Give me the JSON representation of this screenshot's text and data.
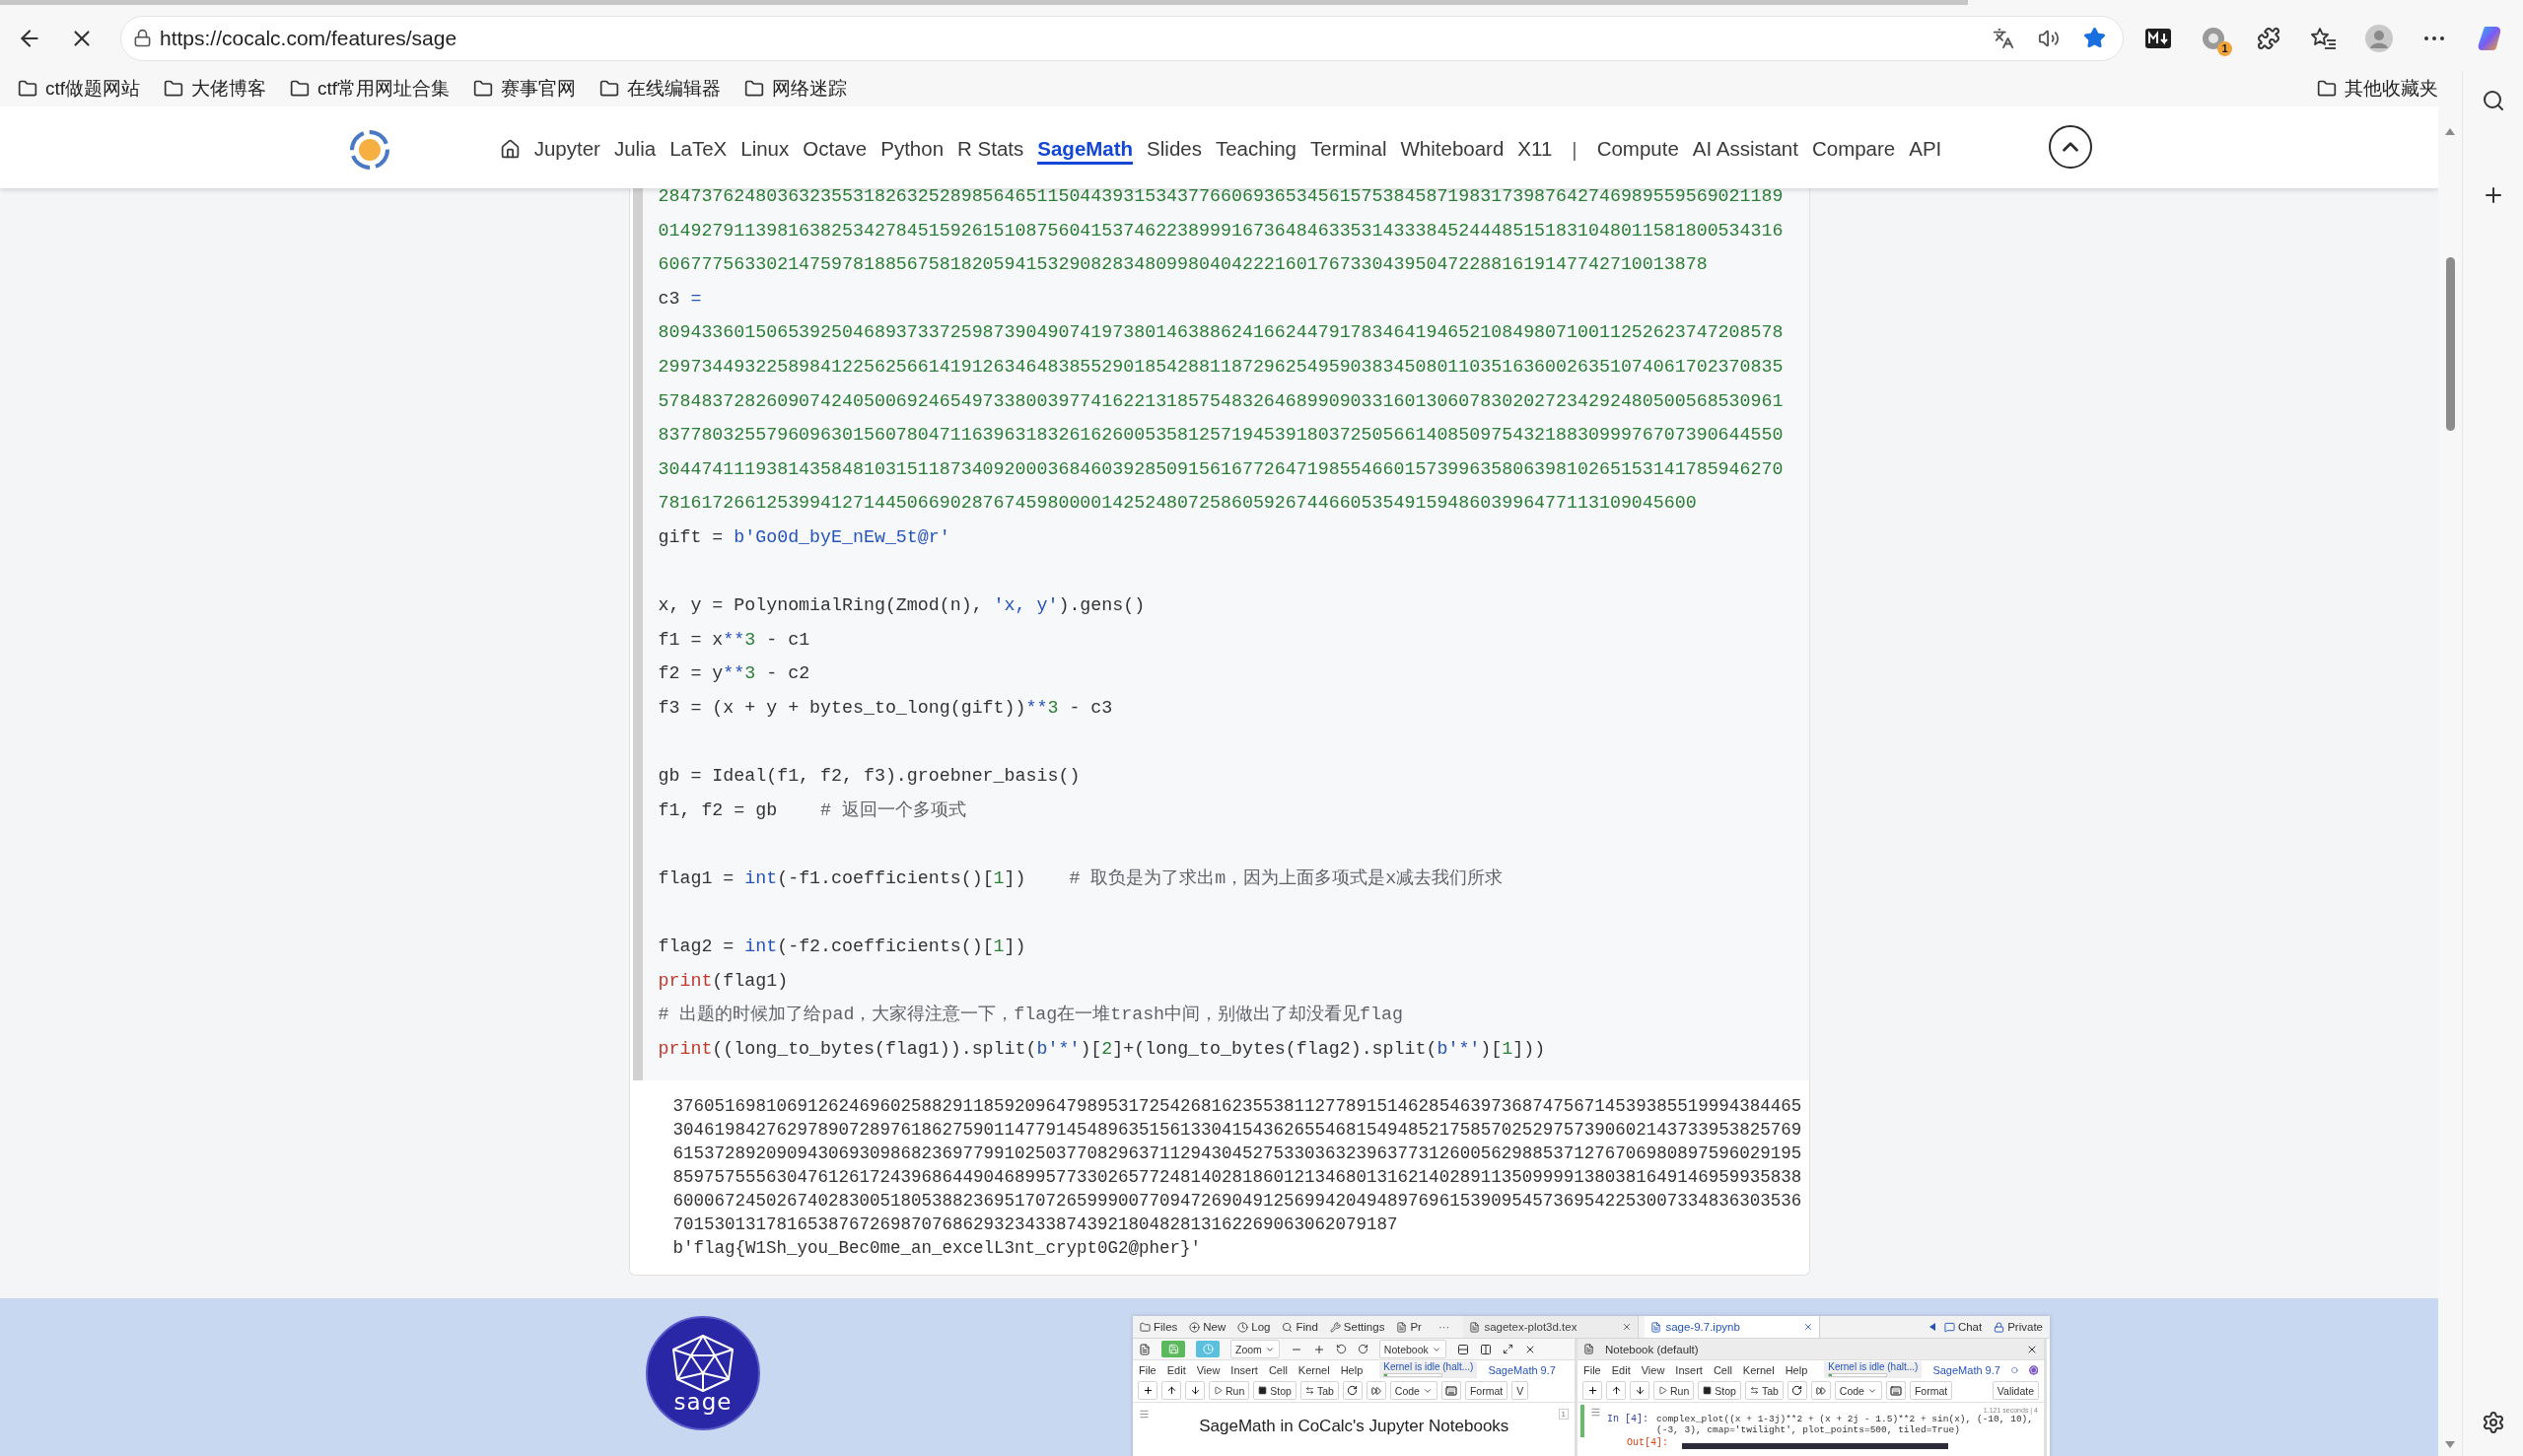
{
  "browser": {
    "load_progress": {
      "level": 0.78
    },
    "url": "https://cocalc.com/features/sage",
    "bookmarked": true,
    "extension_badge": "1",
    "bookmarks": [
      "ctf做题网站",
      "大佬博客",
      "ctf常用网址合集",
      "赛事官网",
      "在线编辑器",
      "网络迷踪"
    ],
    "other_bookmarks": "其他收藏夹"
  },
  "site_header": {
    "nav": [
      {
        "kind": "home",
        "selected": false
      },
      {
        "kind": "link",
        "label": "Jupyter",
        "selected": false
      },
      {
        "kind": "link",
        "label": "Julia",
        "selected": false
      },
      {
        "kind": "link",
        "label": "LaTeX",
        "selected": false
      },
      {
        "kind": "link",
        "label": "Linux",
        "selected": false
      },
      {
        "kind": "link",
        "label": "Octave",
        "selected": false
      },
      {
        "kind": "link",
        "label": "Python",
        "selected": false
      },
      {
        "kind": "link",
        "label": "R Stats",
        "selected": false
      },
      {
        "kind": "link",
        "label": "SageMath",
        "selected": true
      },
      {
        "kind": "link",
        "label": "Slides",
        "selected": false
      },
      {
        "kind": "link",
        "label": "Teaching",
        "selected": false
      },
      {
        "kind": "link",
        "label": "Terminal",
        "selected": false
      },
      {
        "kind": "link",
        "label": "Whiteboard",
        "selected": false
      },
      {
        "kind": "link",
        "label": "X11",
        "selected": false
      },
      {
        "kind": "separator",
        "label": "|"
      },
      {
        "kind": "link",
        "label": "Compute",
        "selected": false
      },
      {
        "kind": "link",
        "label": "AI Assistant",
        "selected": false
      },
      {
        "kind": "link",
        "label": "Compare",
        "selected": false
      },
      {
        "kind": "link",
        "label": "API",
        "selected": false
      }
    ]
  },
  "code_cell": {
    "lines": [
      {
        "kind": "code",
        "tokens": [
          {
            "text": "28473762480363235531826325289856465115044393153437766069365345615753845871983173987642746989559569021189",
            "kind": "number"
          }
        ]
      },
      {
        "kind": "code",
        "tokens": [
          {
            "text": "01492791139816382534278451592615108756041537462238999167364846335314333845244485151831048011581800534316",
            "kind": "number"
          }
        ]
      },
      {
        "kind": "code",
        "tokens": [
          {
            "text": "6067775633021475978188567581820594153290828348099804042221601767330439504722881619147742710013878",
            "kind": "number"
          }
        ]
      },
      {
        "kind": "code",
        "tokens": [
          {
            "text": "c3 ",
            "kind": "plain"
          },
          {
            "text": "=",
            "kind": "operator"
          }
        ]
      },
      {
        "kind": "code",
        "tokens": [
          {
            "text": "80943360150653925046893733725987390490741973801463886241662447917834641946521084980710011252623747208578",
            "kind": "number"
          }
        ]
      },
      {
        "kind": "code",
        "tokens": [
          {
            "text": "29973449322589841225625661419126346483855290185428811872962549590383450801103516360026351074061702370835",
            "kind": "number"
          }
        ]
      },
      {
        "kind": "code",
        "tokens": [
          {
            "text": "57848372826090742405006924654973380039774162213185754832646899090331601306078302027234292480500568530961",
            "kind": "number"
          }
        ]
      },
      {
        "kind": "code",
        "tokens": [
          {
            "text": "83778032557960963015607804711639631832616260053581257194539180372505661408509754321883099976707390644550",
            "kind": "number"
          }
        ]
      },
      {
        "kind": "code",
        "tokens": [
          {
            "text": "30447411193814358481031511873409200036846039285091561677264719855466015739963580639810265153141785946270",
            "kind": "number"
          }
        ]
      },
      {
        "kind": "code",
        "tokens": [
          {
            "text": "781617266125399412714450669028767459800001425248072586059267446605354915948603996477113109045600",
            "kind": "number"
          }
        ]
      },
      {
        "kind": "code",
        "tokens": [
          {
            "text": "gift = ",
            "kind": "plain"
          },
          {
            "text": "b'Go0d_byE_nEw_5t@r'",
            "kind": "string"
          }
        ]
      },
      {
        "kind": "blank"
      },
      {
        "kind": "code",
        "tokens": [
          {
            "text": "x, y = PolynomialRing(Zmod(n), ",
            "kind": "plain"
          },
          {
            "text": "'x, y'",
            "kind": "string"
          },
          {
            "text": ").gens()",
            "kind": "plain"
          }
        ]
      },
      {
        "kind": "code",
        "tokens": [
          {
            "text": "f1 = x",
            "kind": "plain"
          },
          {
            "text": "**",
            "kind": "operator"
          },
          {
            "text": "3",
            "kind": "number"
          },
          {
            "text": " - c1",
            "kind": "plain"
          }
        ]
      },
      {
        "kind": "code",
        "tokens": [
          {
            "text": "f2 = y",
            "kind": "plain"
          },
          {
            "text": "**",
            "kind": "operator"
          },
          {
            "text": "3",
            "kind": "number"
          },
          {
            "text": " - c2",
            "kind": "plain"
          }
        ]
      },
      {
        "kind": "code",
        "tokens": [
          {
            "text": "f3 = (x + y + bytes_to_long(gift))",
            "kind": "plain"
          },
          {
            "text": "**",
            "kind": "operator"
          },
          {
            "text": "3",
            "kind": "number"
          },
          {
            "text": " - c3",
            "kind": "plain"
          }
        ]
      },
      {
        "kind": "blank"
      },
      {
        "kind": "code",
        "tokens": [
          {
            "text": "gb = Ideal(f1, f2, f3).groebner_basis()",
            "kind": "plain"
          }
        ]
      },
      {
        "kind": "code",
        "tokens": [
          {
            "text": "f1, f2 = gb    ",
            "kind": "plain"
          },
          {
            "text": "# 返回一个多项式",
            "kind": "comment"
          }
        ]
      },
      {
        "kind": "blank"
      },
      {
        "kind": "code",
        "tokens": [
          {
            "text": "flag1 = ",
            "kind": "plain"
          },
          {
            "text": "int",
            "kind": "keyword"
          },
          {
            "text": "(-f1.coefficients()[",
            "kind": "plain"
          },
          {
            "text": "1",
            "kind": "number"
          },
          {
            "text": "])    ",
            "kind": "plain"
          },
          {
            "text": "# 取负是为了求出m，因为上面多项式是x减去我们所求",
            "kind": "comment"
          }
        ]
      },
      {
        "kind": "blank"
      },
      {
        "kind": "code",
        "tokens": [
          {
            "text": "flag2 = ",
            "kind": "plain"
          },
          {
            "text": "int",
            "kind": "keyword"
          },
          {
            "text": "(-f2.coefficients()[",
            "kind": "plain"
          },
          {
            "text": "1",
            "kind": "number"
          },
          {
            "text": "])",
            "kind": "plain"
          }
        ]
      },
      {
        "kind": "code",
        "tokens": [
          {
            "text": "print",
            "kind": "builtin"
          },
          {
            "text": "(flag1)",
            "kind": "plain"
          }
        ]
      },
      {
        "kind": "code",
        "tokens": [
          {
            "text": "# 出题的时候加了给pad，大家得注意一下，flag在一堆trash中间，别做出了却没看见flag",
            "kind": "comment"
          }
        ]
      },
      {
        "kind": "code",
        "tokens": [
          {
            "text": "print",
            "kind": "builtin"
          },
          {
            "text": "((long_to_bytes(flag1)).split(",
            "kind": "plain"
          },
          {
            "text": "b'*'",
            "kind": "string"
          },
          {
            "text": ")[",
            "kind": "plain"
          },
          {
            "text": "2",
            "kind": "number"
          },
          {
            "text": "]+(long_to_bytes(flag2).split(",
            "kind": "plain"
          },
          {
            "text": "b'*'",
            "kind": "string"
          },
          {
            "text": ")[",
            "kind": "plain"
          },
          {
            "text": "1",
            "kind": "number"
          },
          {
            "text": "]))",
            "kind": "plain"
          }
        ]
      }
    ],
    "output": [
      "3760516981069126246960258829118592096479895317254268162355381127789151462854639736874756714539385519994384465",
      "3046198427629789072897618627590114779145489635156133041543626554681549485217585702529757390602143733953825769",
      "6153728920909430693098682369779910250377082963711294304527533036323963773126005629885371276706980897596029195",
      "8597575556304761261724396864490468995773302657724814028186012134680131621402891135099991380381649146959935838",
      "6000672450267402830051805388236951707265999007709472690491256994204948976961539095457369542253007334836303536",
      "7015301317816538767269870768629323433874392180482813162269063062079187",
      "b'flag{W1Sh_you_Bec0me_an_excelL3nt_crypt0G2@pher}'"
    ]
  },
  "feature": {
    "logo_text": "sage",
    "app_screenshot": {
      "activity_tabs": [
        "Files",
        "New",
        "Log",
        "Find",
        "Settings",
        "Pr"
      ],
      "overflow": "···",
      "file_tabs": [
        {
          "label": "sagetex-plot3d.tex",
          "selected": false
        },
        {
          "label": "sage-9.7.ipynb",
          "selected": true
        }
      ],
      "actions": [
        "Chat",
        "Private"
      ],
      "left_pane": {
        "zoom": "Zoom",
        "view": "Notebook",
        "menu": [
          "File",
          "Edit",
          "View",
          "Insert",
          "Cell",
          "Kernel",
          "Help"
        ],
        "kernel_status": "Kernel is idle (halt...)",
        "kernel_meter": {
          "level": 0.04
        },
        "kernel": "SageMath 9.7",
        "buttons": [
          "Run",
          "Stop",
          "Tab"
        ],
        "cell_type": "Code",
        "format": "Format",
        "validate": "V",
        "caption": "SageMath in CoCalc's Jupyter Notebooks",
        "page_number": "1"
      },
      "right_pane": {
        "title": "Notebook (default)",
        "menu": [
          "File",
          "Edit",
          "View",
          "Insert",
          "Cell",
          "Kernel",
          "Help"
        ],
        "kernel_status": "Kernel is idle (halt...)",
        "kernel_meter": {
          "level": 0.04
        },
        "kernel": "SageMath 9.7",
        "buttons": [
          "Run",
          "Stop",
          "Tab"
        ],
        "cell_type": "Code",
        "format": "Format",
        "validate": "Validate",
        "input_prompt": "In [4]:",
        "code": [
          "complex_plot((x + 1-3j)**2 + (x + 2j - 1.5)**2 + sin(x), (-10, 10),",
          "(-3, 3), cmap='twilight', plot_points=500, tiled=True)"
        ],
        "timing": "1.121 seconds | 4",
        "output_prompt": "Out[4]:"
      }
    }
  }
}
